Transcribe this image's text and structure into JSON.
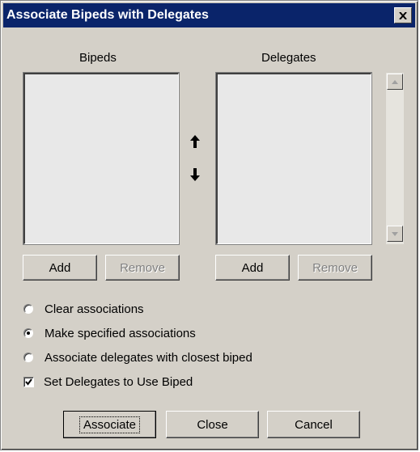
{
  "window": {
    "title": "Associate Bipeds with Delegates",
    "close_icon": "close-x-icon"
  },
  "bipeds": {
    "label": "Bipeds",
    "items": [],
    "add_label": "Add",
    "remove_label": "Remove"
  },
  "delegates": {
    "label": "Delegates",
    "items": [],
    "add_label": "Add",
    "remove_label": "Remove"
  },
  "arrows": {
    "up_icon": "arrow-up-icon",
    "down_icon": "arrow-down-icon"
  },
  "options": {
    "clear": {
      "label": "Clear associations",
      "selected": false
    },
    "make": {
      "label": "Make specified associations",
      "selected": true
    },
    "closest": {
      "label": "Associate delegates with closest biped",
      "selected": false
    }
  },
  "set_delegates": {
    "label": "Set Delegates to Use Biped",
    "checked": true
  },
  "footer": {
    "associate_label": "Associate",
    "close_label": "Close",
    "cancel_label": "Cancel"
  },
  "colors": {
    "title_bar": "#0a246a",
    "dialog_face": "#d4d0c8",
    "disabled_text": "#808080"
  }
}
